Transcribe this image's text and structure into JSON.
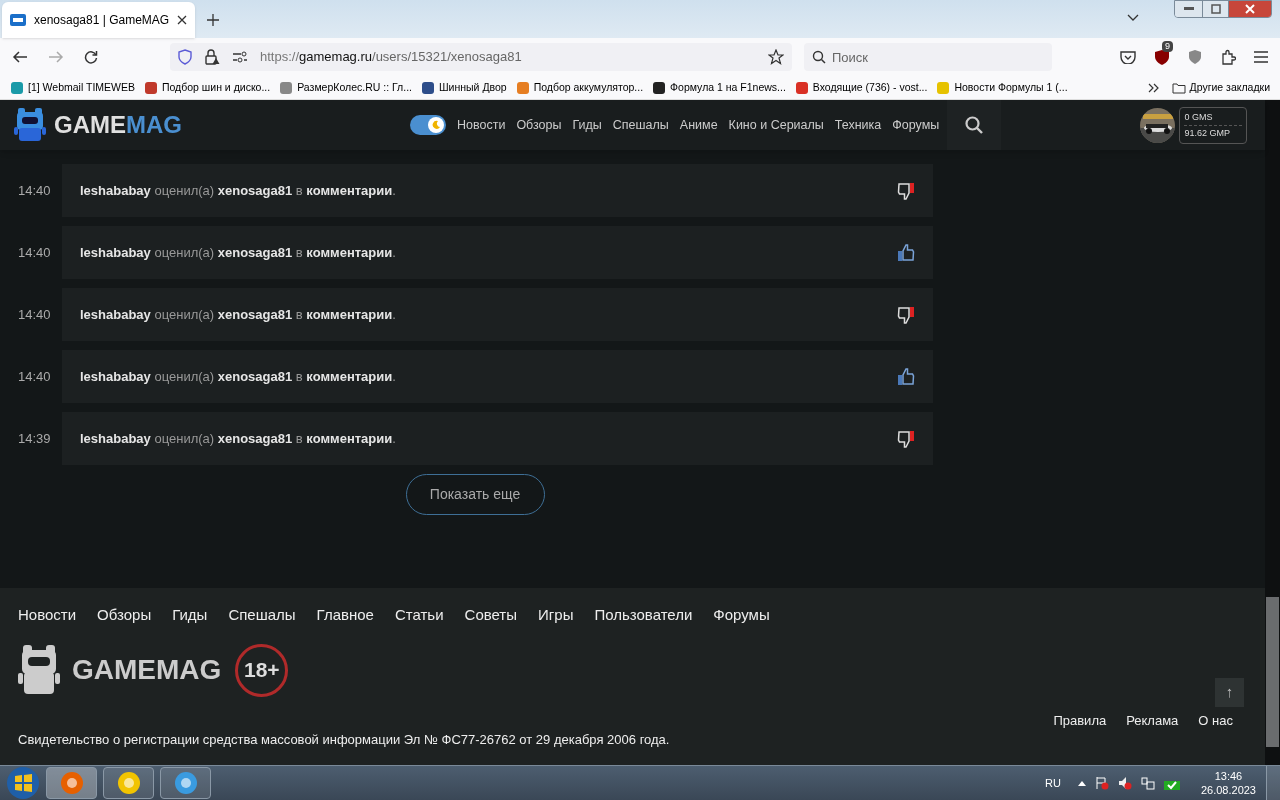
{
  "browser": {
    "tab_title": "xenosaga81 | GameMAG",
    "url_host": "https://gamemag.ru",
    "url_path": "/users/15321/xenosaga81",
    "search_placeholder": "Поиск",
    "extension_badge": "9",
    "bookmarks": [
      "[1] Webmail TIMEWEB",
      "Подбор шин и диско...",
      "РазмерКолес.RU :: Гл...",
      "Шинный Двор",
      "Подбор аккумулятор...",
      "Формула 1 на F1news...",
      "Входящие (736) - vost...",
      "Новости Формулы 1 (..."
    ],
    "other_bookmarks": "Другие закладки"
  },
  "header": {
    "logo_first": "GAME",
    "logo_second": "MAG",
    "dark_mode": true,
    "nav": [
      "Новости",
      "Обзоры",
      "Гиды",
      "Спешалы",
      "Аниме",
      "Кино и Сериалы",
      "Техника",
      "Форумы"
    ],
    "wallet": [
      "0 GMS",
      "91.62 GMP"
    ]
  },
  "activity": [
    {
      "time": "14:40",
      "text": "**leshababay** оценил(а) **xenosaga81** в **комментарии**.",
      "kind": "dislike"
    },
    {
      "time": "14:40",
      "text": "**leshababay** оценил(а) **xenosaga81** в **комментарии**.",
      "kind": "like"
    },
    {
      "time": "14:40",
      "text": "**leshababay** оценил(а) **xenosaga81** в **комментарии**.",
      "kind": "dislike"
    },
    {
      "time": "14:40",
      "text": "**leshababay** оценил(а) **xenosaga81** в **комментарии**.",
      "kind": "like"
    },
    {
      "time": "14:39",
      "text": "**leshababay** оценил(а) **xenosaga81** в **комментарии**.",
      "kind": "dislike"
    }
  ],
  "show_more": "Показать еще",
  "footer": {
    "nav": [
      "Новости",
      "Обзоры",
      "Гиды",
      "Спешалы",
      "Главное",
      "Статьи",
      "Советы",
      "Игры",
      "Пользователи",
      "Форумы"
    ],
    "logo": "GAMEMAG",
    "age": "18+",
    "links": [
      "Правила",
      "Реклама",
      "О нас"
    ],
    "up": "↑",
    "certificate": "Свидетельство о регистрации средства массовой информации Эл № ФС77-26762 от 29 декабря 2006 года."
  },
  "taskbar": {
    "language": "RU",
    "time": "13:46",
    "date": "26.08.2023"
  }
}
